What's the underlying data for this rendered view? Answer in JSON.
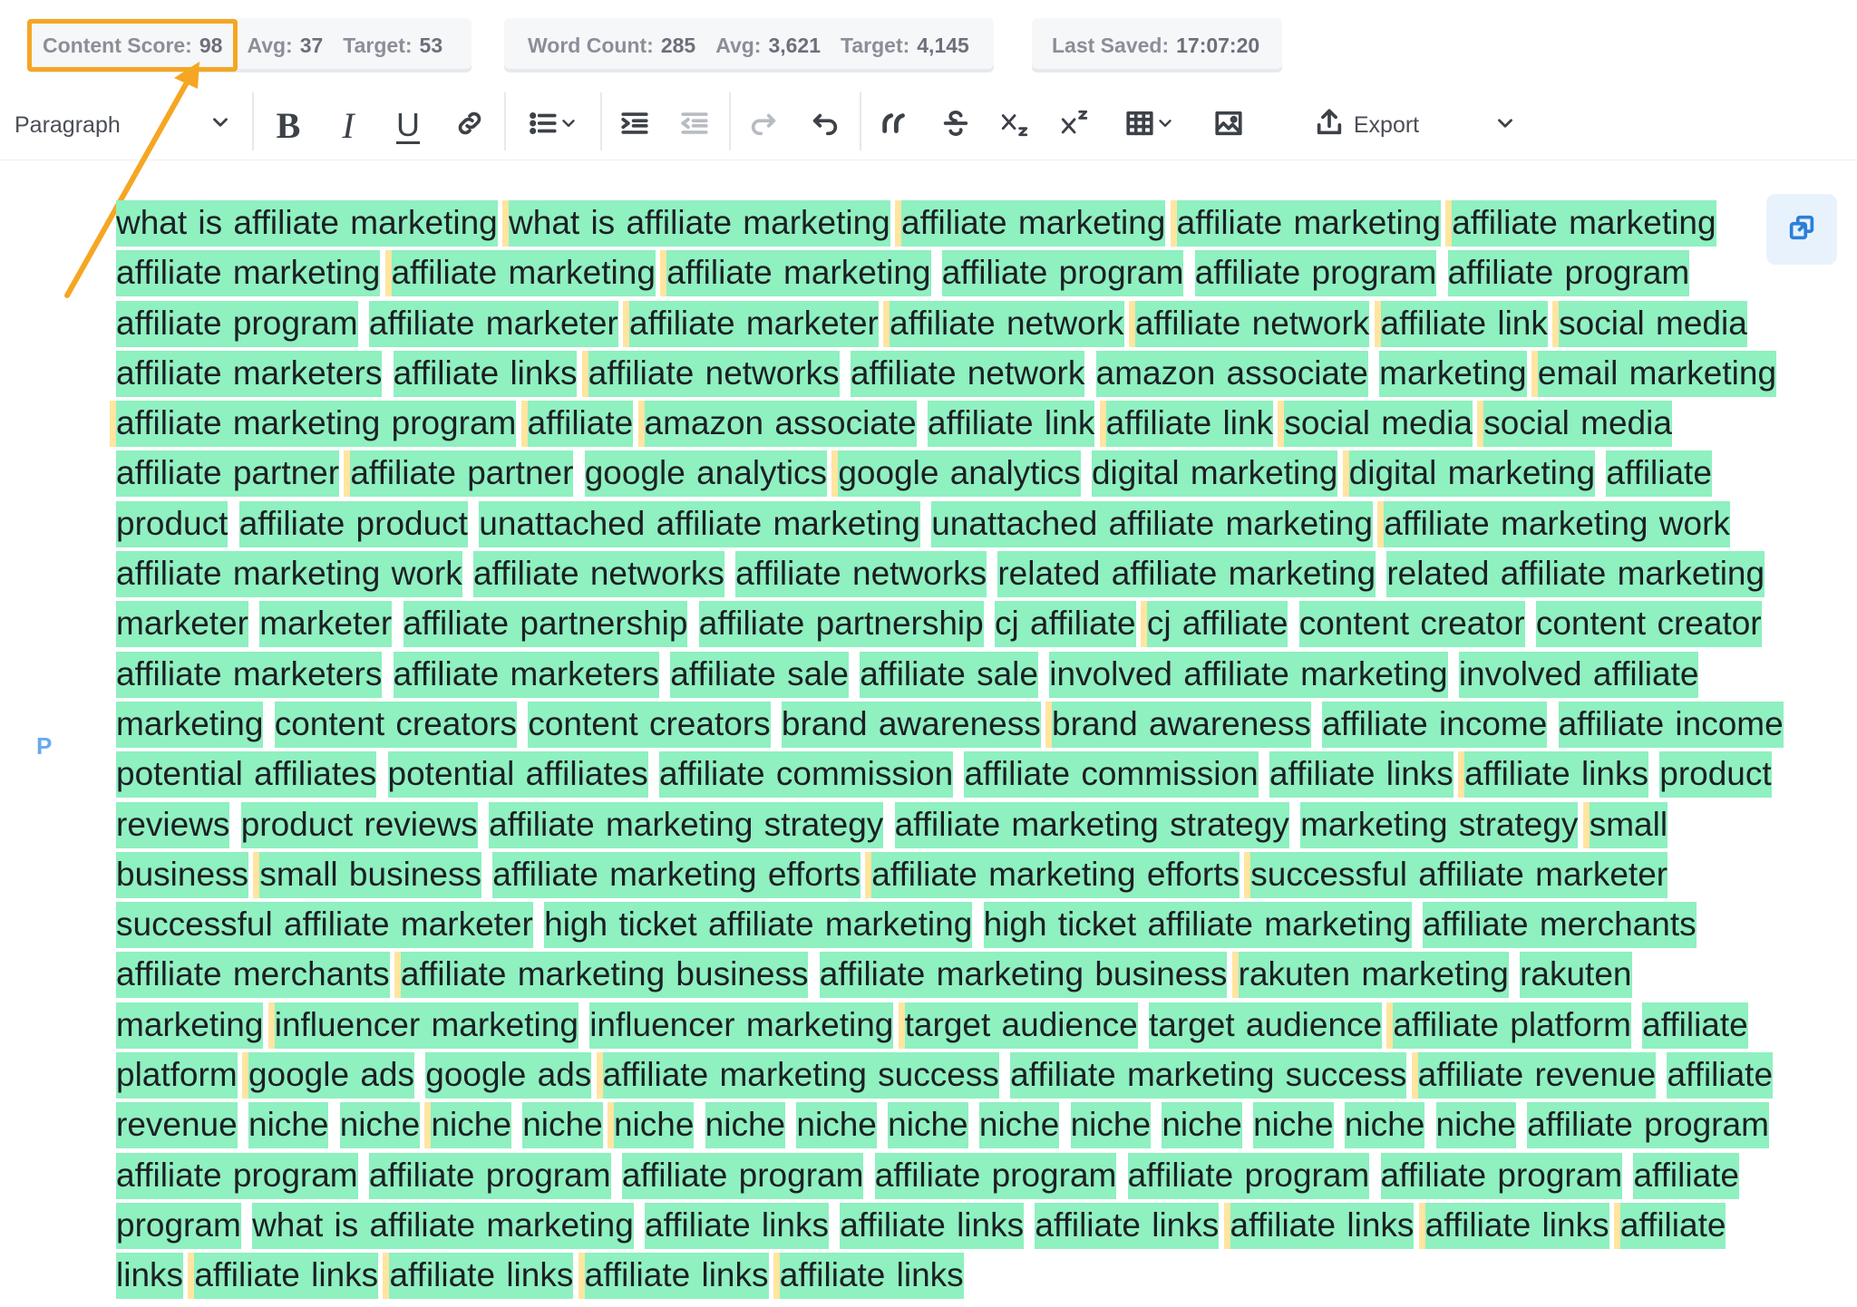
{
  "stats": {
    "content_score_label": "Content Score:",
    "content_score_value": "98",
    "score_avg_label": "Avg:",
    "score_avg_value": "37",
    "score_target_label": "Target:",
    "score_target_value": "53",
    "word_count_label": "Word Count:",
    "word_count_value": "285",
    "word_avg_label": "Avg:",
    "word_avg_value": "3,621",
    "word_target_label": "Target:",
    "word_target_value": "4,145",
    "last_saved_label": "Last Saved:",
    "last_saved_value": "17:07:20"
  },
  "toolbar": {
    "block_format": "Paragraph",
    "bold_label": "B",
    "italic_label": "I",
    "underline_label": "U",
    "export_label": "Export",
    "icons": [
      "bold-icon",
      "italic-icon",
      "underline-icon",
      "link-icon",
      "bulleted-list-icon",
      "indent-icon",
      "outdent-icon",
      "redo-icon",
      "undo-icon",
      "blockquote-icon",
      "strikethrough-icon",
      "subscript-icon",
      "superscript-icon",
      "table-icon",
      "image-icon",
      "export-icon"
    ]
  },
  "editor": {
    "paragraph_marker": "P",
    "keywords": [
      "what is affiliate marketing",
      "what is affiliate marketing",
      "affiliate marketing",
      "affiliate marketing",
      "affiliate marketing",
      "affiliate marketing",
      "affiliate marketing",
      "affiliate marketing",
      "affiliate program",
      "affiliate program",
      "affiliate program",
      "affiliate program",
      "affiliate marketer",
      "affiliate marketer",
      "affiliate network",
      "affiliate network",
      "affiliate link",
      "social media",
      "affiliate marketers",
      "affiliate links",
      "affiliate networks",
      "affiliate network",
      "amazon associate",
      "marketing",
      "email marketing",
      "affiliate marketing program",
      "affiliate",
      "amazon associate",
      "affiliate link",
      "affiliate link",
      "social media",
      "social media",
      "affiliate partner",
      "affiliate partner",
      "google analytics",
      "google analytics",
      "digital marketing",
      "digital marketing",
      "affiliate product",
      "affiliate product",
      "unattached affiliate marketing",
      "unattached affiliate marketing",
      "affiliate marketing work",
      "affiliate marketing work",
      "affiliate networks",
      "affiliate networks",
      "related affiliate marketing",
      "related affiliate marketing",
      "marketer",
      "marketer",
      "affiliate partnership",
      "affiliate partnership",
      "cj affiliate",
      "cj affiliate",
      "content creator",
      "content creator",
      "affiliate marketers",
      "affiliate marketers",
      "affiliate sale",
      "affiliate sale",
      "involved affiliate marketing",
      "involved affiliate marketing",
      "content creators",
      "content creators",
      "brand awareness",
      "brand awareness",
      "affiliate income",
      "affiliate income",
      "potential affiliates",
      "potential affiliates",
      "affiliate commission",
      "affiliate commission",
      "affiliate links",
      "affiliate links",
      "product reviews",
      "product reviews",
      "affiliate marketing strategy",
      "affiliate marketing strategy",
      "marketing strategy",
      "small business",
      "small business",
      "affiliate marketing efforts",
      "affiliate marketing efforts",
      "successful affiliate marketer",
      "successful affiliate marketer",
      "high ticket affiliate marketing",
      "high ticket affiliate marketing",
      "affiliate merchants",
      "affiliate merchants",
      "affiliate marketing business",
      "affiliate marketing business",
      "rakuten marketing",
      "rakuten marketing",
      "influencer marketing",
      "influencer marketing",
      "target audience",
      "target audience",
      "affiliate platform",
      "affiliate platform",
      "google ads",
      "google ads",
      "affiliate marketing success",
      "affiliate marketing success",
      "affiliate revenue",
      "affiliate revenue",
      "niche",
      "niche",
      "niche",
      "niche",
      "niche",
      "niche",
      "niche",
      "niche",
      "niche",
      "niche",
      "niche",
      "niche",
      "niche",
      "niche",
      "affiliate program",
      "affiliate program",
      "affiliate program",
      "affiliate program",
      "affiliate program",
      "affiliate program",
      "affiliate program",
      "affiliate program",
      "what is affiliate marketing",
      "affiliate links",
      "affiliate links",
      "affiliate links",
      "affiliate links",
      "affiliate links",
      "affiliate links",
      "affiliate links",
      "affiliate links",
      "affiliate links",
      "affiliate links"
    ],
    "yellow_separator_before": [
      1,
      2,
      3,
      4,
      6,
      7,
      13,
      14,
      15,
      16,
      17,
      20,
      24,
      25,
      26,
      27,
      29,
      30,
      31,
      33,
      35,
      37,
      42,
      53,
      65,
      73,
      79,
      80,
      82,
      83,
      89,
      91,
      93,
      95,
      97,
      99,
      101,
      103,
      107,
      109,
      131,
      132,
      133,
      134,
      135,
      136,
      137,
      138,
      139
    ],
    "highlight_color": "#8ff0c0",
    "separator_color": "#ffe5a0",
    "accent_color": "#f5a623"
  }
}
